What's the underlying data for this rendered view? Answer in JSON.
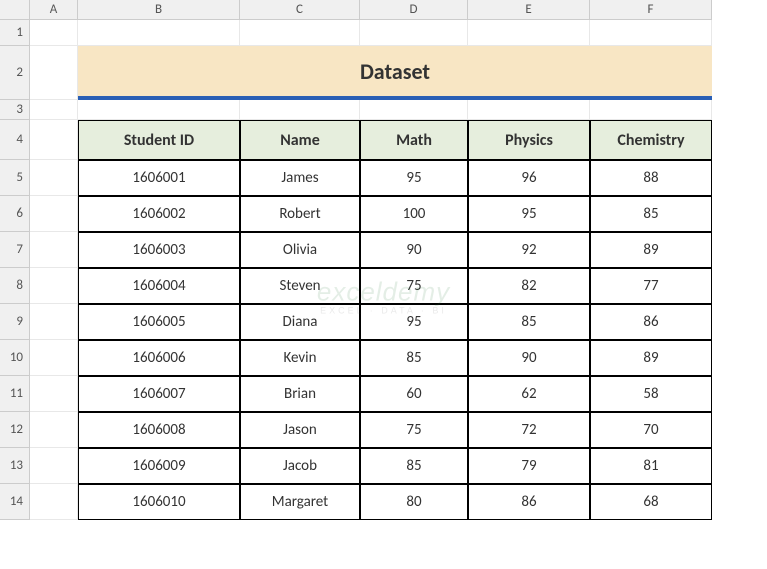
{
  "columns": [
    "A",
    "B",
    "C",
    "D",
    "E",
    "F"
  ],
  "rows": [
    "1",
    "2",
    "3",
    "4",
    "5",
    "6",
    "7",
    "8",
    "9",
    "10",
    "11",
    "12",
    "13",
    "14"
  ],
  "title": "Dataset",
  "headers": [
    "Student ID",
    "Name",
    "Math",
    "Physics",
    "Chemistry"
  ],
  "data": [
    [
      "1606001",
      "James",
      "95",
      "96",
      "88"
    ],
    [
      "1606002",
      "Robert",
      "100",
      "95",
      "85"
    ],
    [
      "1606003",
      "Olivia",
      "90",
      "92",
      "89"
    ],
    [
      "1606004",
      "Steven",
      "75",
      "82",
      "77"
    ],
    [
      "1606005",
      "Diana",
      "95",
      "85",
      "86"
    ],
    [
      "1606006",
      "Kevin",
      "85",
      "90",
      "89"
    ],
    [
      "1606007",
      "Brian",
      "60",
      "62",
      "58"
    ],
    [
      "1606008",
      "Jason",
      "75",
      "72",
      "70"
    ],
    [
      "1606009",
      "Jacob",
      "85",
      "79",
      "81"
    ],
    [
      "1606010",
      "Margaret",
      "80",
      "86",
      "68"
    ]
  ],
  "watermark": {
    "line1": "exceldemy",
    "line2": "EXCEL · DATA · BI"
  },
  "chart_data": {
    "type": "table",
    "title": "Dataset",
    "columns": [
      "Student ID",
      "Name",
      "Math",
      "Physics",
      "Chemistry"
    ],
    "rows": [
      {
        "Student ID": 1606001,
        "Name": "James",
        "Math": 95,
        "Physics": 96,
        "Chemistry": 88
      },
      {
        "Student ID": 1606002,
        "Name": "Robert",
        "Math": 100,
        "Physics": 95,
        "Chemistry": 85
      },
      {
        "Student ID": 1606003,
        "Name": "Olivia",
        "Math": 90,
        "Physics": 92,
        "Chemistry": 89
      },
      {
        "Student ID": 1606004,
        "Name": "Steven",
        "Math": 75,
        "Physics": 82,
        "Chemistry": 77
      },
      {
        "Student ID": 1606005,
        "Name": "Diana",
        "Math": 95,
        "Physics": 85,
        "Chemistry": 86
      },
      {
        "Student ID": 1606006,
        "Name": "Kevin",
        "Math": 85,
        "Physics": 90,
        "Chemistry": 89
      },
      {
        "Student ID": 1606007,
        "Name": "Brian",
        "Math": 60,
        "Physics": 62,
        "Chemistry": 58
      },
      {
        "Student ID": 1606008,
        "Name": "Jason",
        "Math": 75,
        "Physics": 72,
        "Chemistry": 70
      },
      {
        "Student ID": 1606009,
        "Name": "Jacob",
        "Math": 85,
        "Physics": 79,
        "Chemistry": 81
      },
      {
        "Student ID": 1606010,
        "Name": "Margaret",
        "Math": 80,
        "Physics": 86,
        "Chemistry": 68
      }
    ]
  }
}
